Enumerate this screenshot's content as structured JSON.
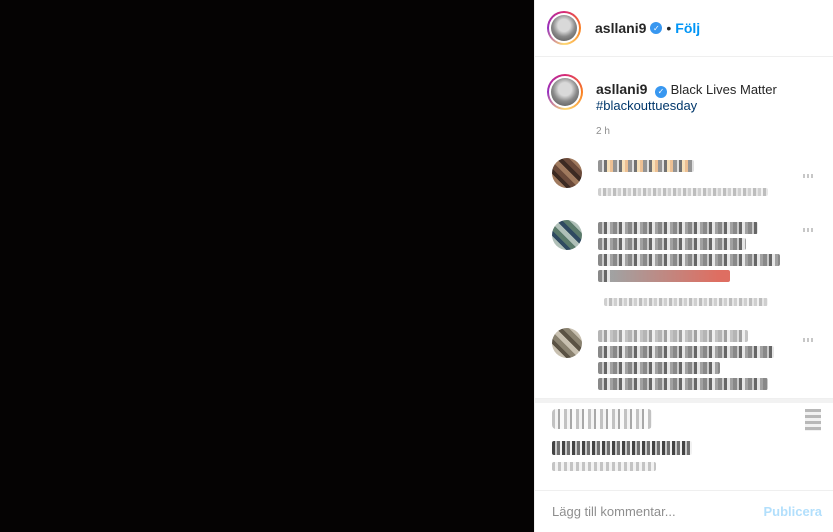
{
  "post": {
    "username": "asllani9",
    "follow_label": "Följ",
    "separator": "•",
    "caption_text": "Black Lives Matter",
    "hashtag": "#blackouttuesday",
    "time_ago": "2 h"
  },
  "comment_box": {
    "placeholder": "Lägg till kommentar...",
    "publish_label": "Publicera"
  },
  "colors": {
    "link_blue": "#0095f6",
    "verified_blue": "#3897f0",
    "publish_disabled": "#b2dffc",
    "media_background": "#050303"
  },
  "icons": {
    "verified": "verified-badge-icon",
    "more": "more-options-icon",
    "bookmark": "bookmark-icon"
  }
}
